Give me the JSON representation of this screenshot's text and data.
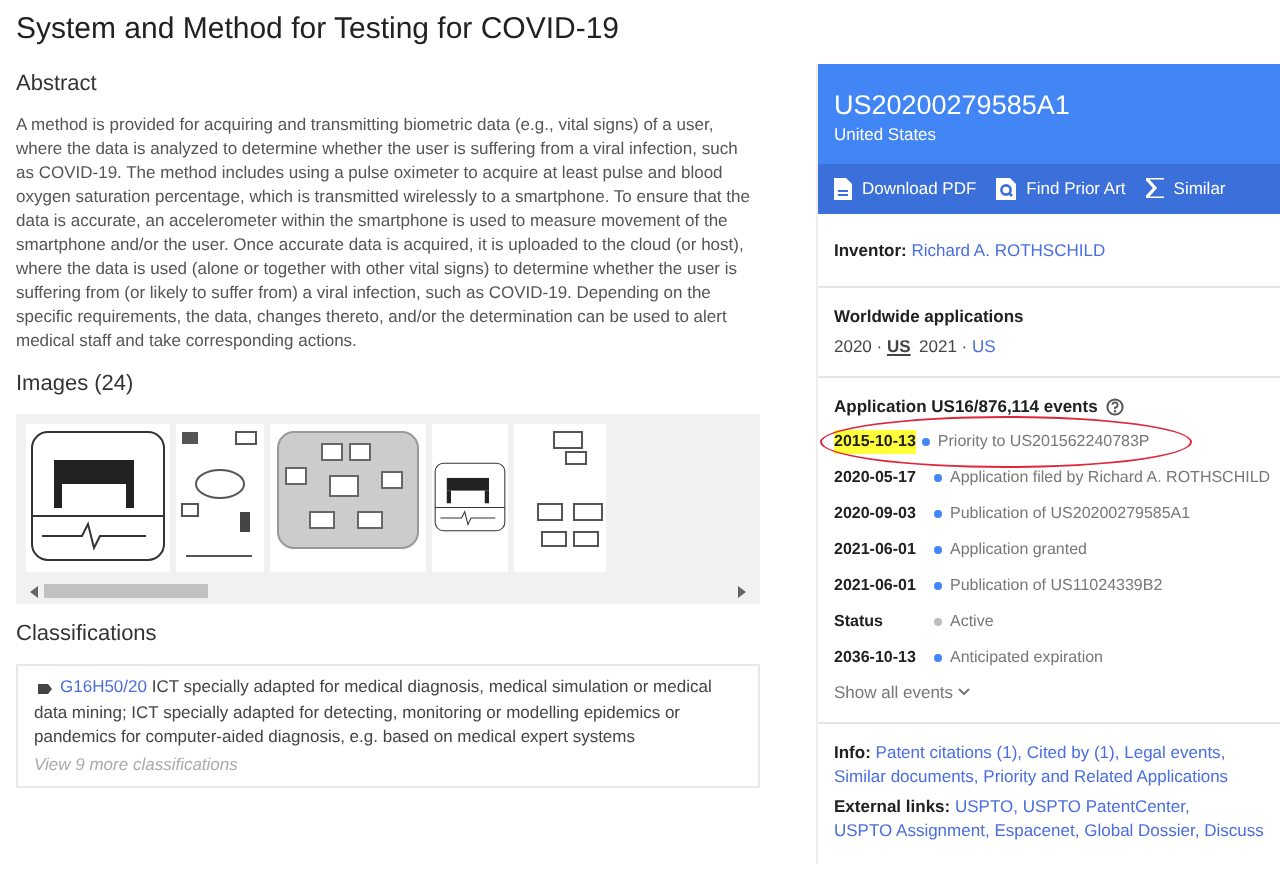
{
  "title": "System and Method for Testing for COVID-19",
  "abstract": {
    "heading": "Abstract",
    "text": "A method is provided for acquiring and transmitting biometric data (e.g., vital signs) of a user, where the data is analyzed to determine whether the user is suffering from a viral infection, such as COVID-19. The method includes using a pulse oximeter to acquire at least pulse and blood oxygen saturation percentage, which is transmitted wirelessly to a smartphone. To ensure that the data is accurate, an accelerometer within the smartphone is used to measure movement of the smartphone and/or the user. Once accurate data is acquired, it is uploaded to the cloud (or host), where the data is used (alone or together with other vital signs) to determine whether the user is suffering from (or likely to suffer from) a viral infection, such as COVID-19. Depending on the specific requirements, the data, changes thereto, and/or the determination can be used to alert medical staff and take corresponding actions."
  },
  "images": {
    "heading": "Images (24)",
    "thumbnails": [
      {
        "kind": "bed"
      },
      {
        "kind": "network"
      },
      {
        "kind": "diagram"
      },
      {
        "kind": "bed"
      },
      {
        "kind": "flow"
      }
    ]
  },
  "classifications": {
    "heading": "Classifications",
    "code": "G16H50/20",
    "description": "ICT specially adapted for medical diagnosis, medical simulation or medical data mining; ICT specially adapted for detecting, monitoring or modelling epidemics or pandemics for computer-aided diagnosis, e.g. based on medical expert systems",
    "more": "View 9 more classifications"
  },
  "panel": {
    "number": "US20200279585A1",
    "country": "United States",
    "actions": [
      {
        "kind": "pdf",
        "label": "Download PDF"
      },
      {
        "kind": "search",
        "label": "Find Prior Art"
      },
      {
        "kind": "sigma",
        "label": "Similar"
      }
    ],
    "inventor_label": "Inventor:",
    "inventor": "Richard A. ROTHSCHILD",
    "worldwide_heading": "Worldwide applications",
    "worldwide": [
      {
        "year": "2020",
        "sep": "·",
        "country": "US",
        "selected": true
      },
      {
        "year": "2021",
        "sep": "·",
        "country": "US",
        "selected": false
      }
    ],
    "events_heading": "Application US16/876,114 events",
    "events": [
      {
        "date": "2015-10-13",
        "text": "Priority to US201562240783P",
        "color": "#4285f4",
        "highlighted": true
      },
      {
        "date": "2020-05-17",
        "text": "Application filed by Richard A. ROTHSCHILD",
        "color": "#4285f4",
        "highlighted": false
      },
      {
        "date": "2020-09-03",
        "text": "Publication of US20200279585A1",
        "color": "#4285f4",
        "highlighted": false
      },
      {
        "date": "2021-06-01",
        "text": "Application granted",
        "color": "#4285f4",
        "highlighted": false
      },
      {
        "date": "2021-06-01",
        "text": "Publication of US11024339B2",
        "color": "#4285f4",
        "highlighted": false
      },
      {
        "date": "Status",
        "text": "Active",
        "color": "#bdbdbd",
        "highlighted": false
      },
      {
        "date": "2036-10-13",
        "text": "Anticipated expiration",
        "color": "#4285f4",
        "highlighted": false
      }
    ],
    "show_all": "Show all events",
    "link_separator": ",",
    "info_label": "Info:",
    "info_links": [
      "Patent citations (1)",
      "Cited by (1)",
      "Legal events",
      "Similar documents",
      "Priority and Related Applications"
    ],
    "external_label": "External links:",
    "external_links": [
      "USPTO",
      "USPTO PatentCenter",
      "USPTO Assignment",
      "Espacenet",
      "Global Dossier",
      "Discuss"
    ]
  }
}
